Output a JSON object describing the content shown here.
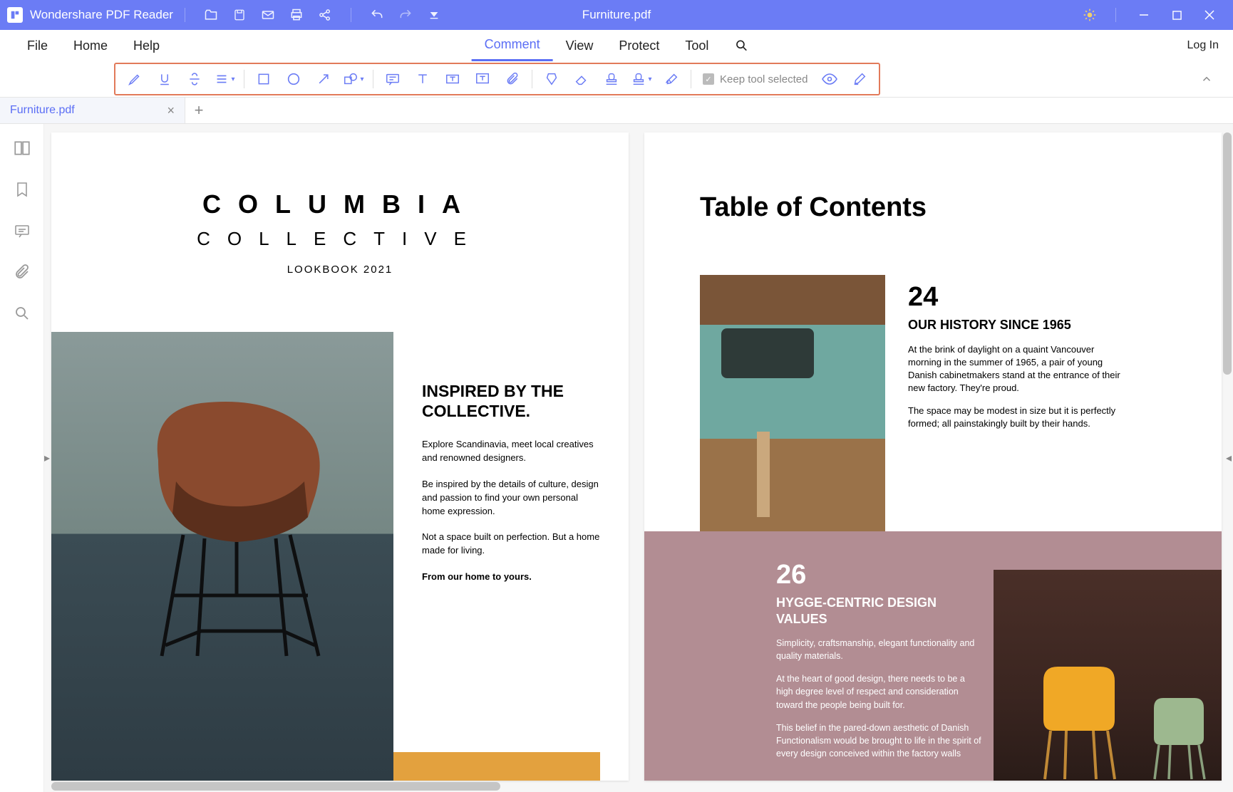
{
  "titlebar": {
    "app_name": "Wondershare PDF Reader",
    "document_title": "Furniture.pdf"
  },
  "menubar": {
    "file": "File",
    "home": "Home",
    "help": "Help",
    "comment": "Comment",
    "view": "View",
    "protect": "Protect",
    "tool": "Tool",
    "login": "Log In"
  },
  "toolbar": {
    "keep_tool_label": "Keep tool selected"
  },
  "tabs": {
    "active": "Furniture.pdf"
  },
  "page1": {
    "title": "COLUMBIA",
    "subtitle": "COLLECTIVE",
    "lookbook": "LOOKBOOK 2021",
    "heading": "INSPIRED BY THE COLLECTIVE.",
    "para1": "Explore Scandinavia, meet local creatives and renowned designers.",
    "para2": "Be inspired by the details of culture, design and passion to find your own personal home expression.",
    "para3": "Not a space built on perfection. But a home made for living.",
    "para4": "From our home to yours."
  },
  "page2": {
    "title": "Table of Contents",
    "num1": "24",
    "head1": "OUR HISTORY SINCE 1965",
    "p1a": "At the brink of daylight on a quaint Vancouver morning in the summer of 1965, a pair of young Danish cabinetmakers stand at the entrance of their new factory. They're proud.",
    "p1b": "The space may be modest in size but it is perfectly formed; all painstakingly built by their hands.",
    "num2": "26",
    "head2": "HYGGE-CENTRIC DESIGN VALUES",
    "p2a": "Simplicity, craftsmanship, elegant functionality and quality materials.",
    "p2b": "At the heart of good design, there needs to be a high degree level of respect and consideration toward the people being built for.",
    "p2c": "This belief in the pared-down aesthetic of Danish Functionalism would be brought to life in the spirit of every design conceived within the factory walls"
  }
}
